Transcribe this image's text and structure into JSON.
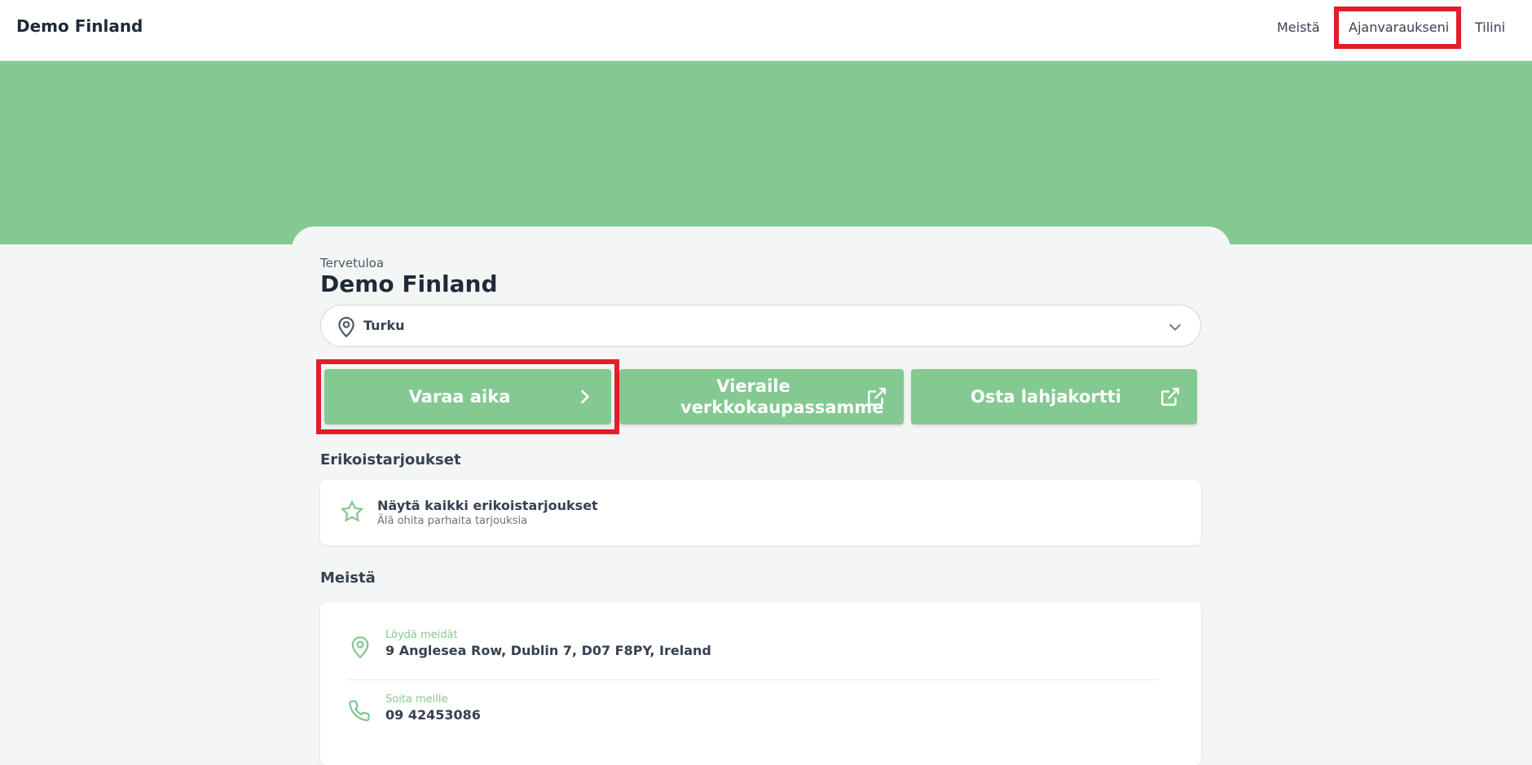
{
  "header": {
    "brand": "Demo Finland",
    "nav": {
      "meista": "Meistä",
      "ajanvaraukseni": "Ajanvaraukseni",
      "tilini": "Tilini"
    }
  },
  "colors": {
    "accent": "#84c991",
    "highlight": "#e31e2a"
  },
  "main": {
    "welcome": "Tervetuloa",
    "title": "Demo Finland",
    "location": {
      "value": "Turku",
      "icon": "map-pin-icon"
    },
    "actions": {
      "book": "Varaa aika",
      "shop": "Vieraile verkkokaupassamme",
      "gift": "Osta lahjakortti"
    },
    "offers": {
      "section_title": "Erikoistarjoukset",
      "title": "Näytä kaikki erikoistarjoukset",
      "subtitle": "Älä ohita parhaita tarjouksia"
    },
    "about": {
      "section_title": "Meistä",
      "address_label": "Löydä meidät",
      "address_value": "9 Anglesea Row, Dublin 7, D07 F8PY, Ireland",
      "phone_label": "Soita meille",
      "phone_value": "09 42453086"
    }
  }
}
